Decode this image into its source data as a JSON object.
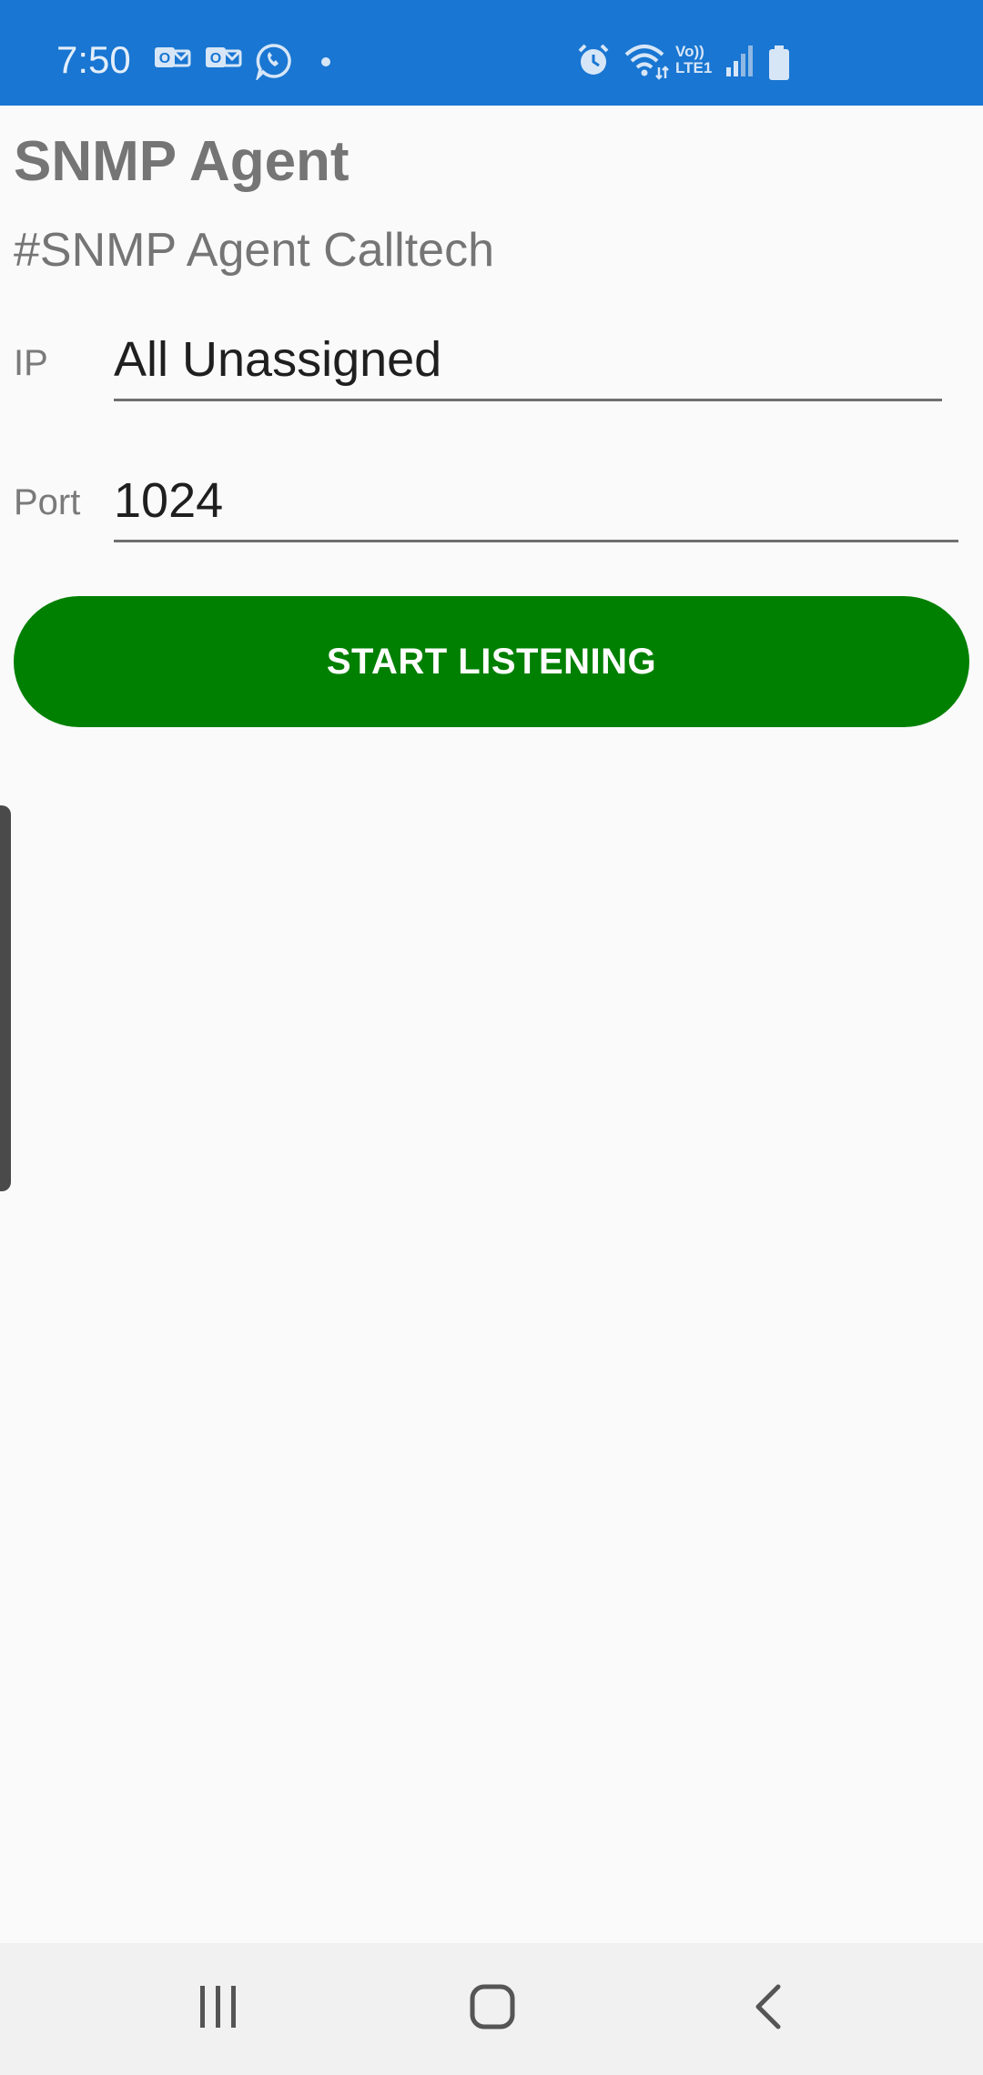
{
  "status_bar": {
    "time": "7:50",
    "left_icons": [
      "outlook-icon",
      "outlook-icon",
      "whatsapp-icon",
      "dot-icon"
    ],
    "right_icons": [
      "alarm-icon",
      "wifi-icon",
      "volte-icon",
      "signal-icon",
      "battery-icon"
    ],
    "volte_text_top": "Vo))",
    "volte_text_bottom": "LTE1",
    "background_color": "#1976d2"
  },
  "app": {
    "title": "SNMP Agent",
    "subtitle": "#SNMP Agent Calltech"
  },
  "form": {
    "ip_label": "IP",
    "ip_value": "All Unassigned",
    "port_label": "Port",
    "port_value": "1024"
  },
  "actions": {
    "start_label": "START LISTENING",
    "start_color": "#008000"
  },
  "nav_bar": {
    "buttons": [
      "recent-apps-icon",
      "home-icon",
      "back-icon"
    ]
  }
}
